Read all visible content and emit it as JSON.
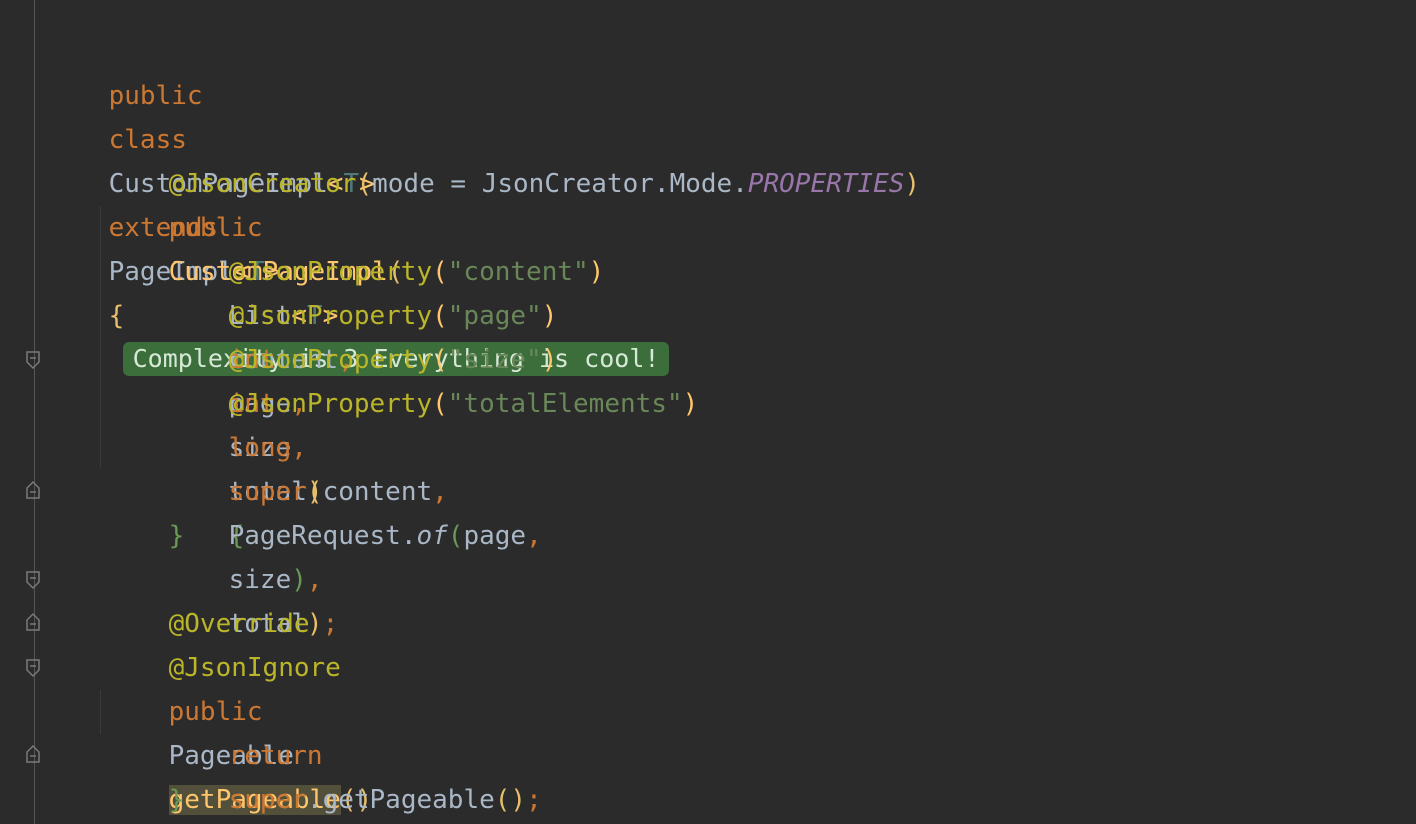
{
  "code": {
    "line1": {
      "kw_public": "public",
      "kw_class": "class",
      "class_name": "CustomPageImpl",
      "lt": "<",
      "type_param": "T",
      "gt": ">",
      "kw_extends": "extends",
      "super_class": "PageImpl",
      "lt2": "<",
      "type_param2": "T",
      "gt2": ">",
      "brace": "{",
      "badge": "Complexity is 3 Everything is cool!"
    },
    "line2": {
      "ann": "@JsonCreator",
      "lp": "(",
      "mode": "mode",
      "eq": " = ",
      "cls": "JsonCreator",
      "dot1": ".",
      "mode_cls": "Mode",
      "dot2": ".",
      "props": "PROPERTIES",
      "rp": ")"
    },
    "line3": {
      "kw_public": "public",
      "ctor": "CustomPageImpl",
      "lp": "("
    },
    "line4": {
      "ann": "@JsonProperty",
      "lp": "(",
      "str": "\"content\"",
      "rp": ")",
      "type": "List",
      "lt": "<",
      "tp": "T",
      "gt": ">",
      "name": "content",
      "comma": ","
    },
    "line5": {
      "ann": "@JsonProperty",
      "lp": "(",
      "str": "\"page\"",
      "rp": ")",
      "kw": "int",
      "name": "page",
      "comma": ","
    },
    "line6": {
      "ann": "@JsonProperty",
      "lp": "(",
      "str": "\"size\"",
      "rp": ")",
      "kw": "int",
      "name": "size",
      "comma": ","
    },
    "line7": {
      "ann": "@JsonProperty",
      "lp": "(",
      "str": "\"totalElements\"",
      "rp": ")",
      "kw": "long",
      "name": "total",
      "rp2": ")",
      "brace": "{"
    },
    "line9": {
      "kw": "super",
      "lp": "(",
      "a1": "content",
      "c1": ",",
      "cls": "PageRequest",
      "dot": ".",
      "of": "of",
      "lp2": "(",
      "a2": "page",
      "c2": ",",
      "a3": "size",
      "rp2": ")",
      "c3": ",",
      "a4": "total",
      "rp": ")",
      "semi": ";"
    },
    "line10": {
      "brace": "}"
    },
    "line12": {
      "ann": "@Override"
    },
    "line13": {
      "ann": "@JsonIgnore"
    },
    "line14": {
      "kw_public": "public",
      "type": "Pageable",
      "method": "getPageable",
      "parens": "()",
      "brace": "{"
    },
    "line15": {
      "kw_return": "return",
      "kw_super": "super",
      "dot": ".",
      "call": "getPageable",
      "parens": "()",
      "semi": ";"
    },
    "line16": {
      "brace": "}"
    },
    "line17": {
      "brace": "}"
    }
  },
  "colors": {
    "background": "#2b2b2b",
    "keyword": "#cc7832",
    "annotation": "#bbb529",
    "string": "#6a8759",
    "constant": "#9876aa",
    "function": "#ffc66d",
    "badge_bg": "#3c6e3c"
  },
  "icons": [
    "fold-icon"
  ]
}
